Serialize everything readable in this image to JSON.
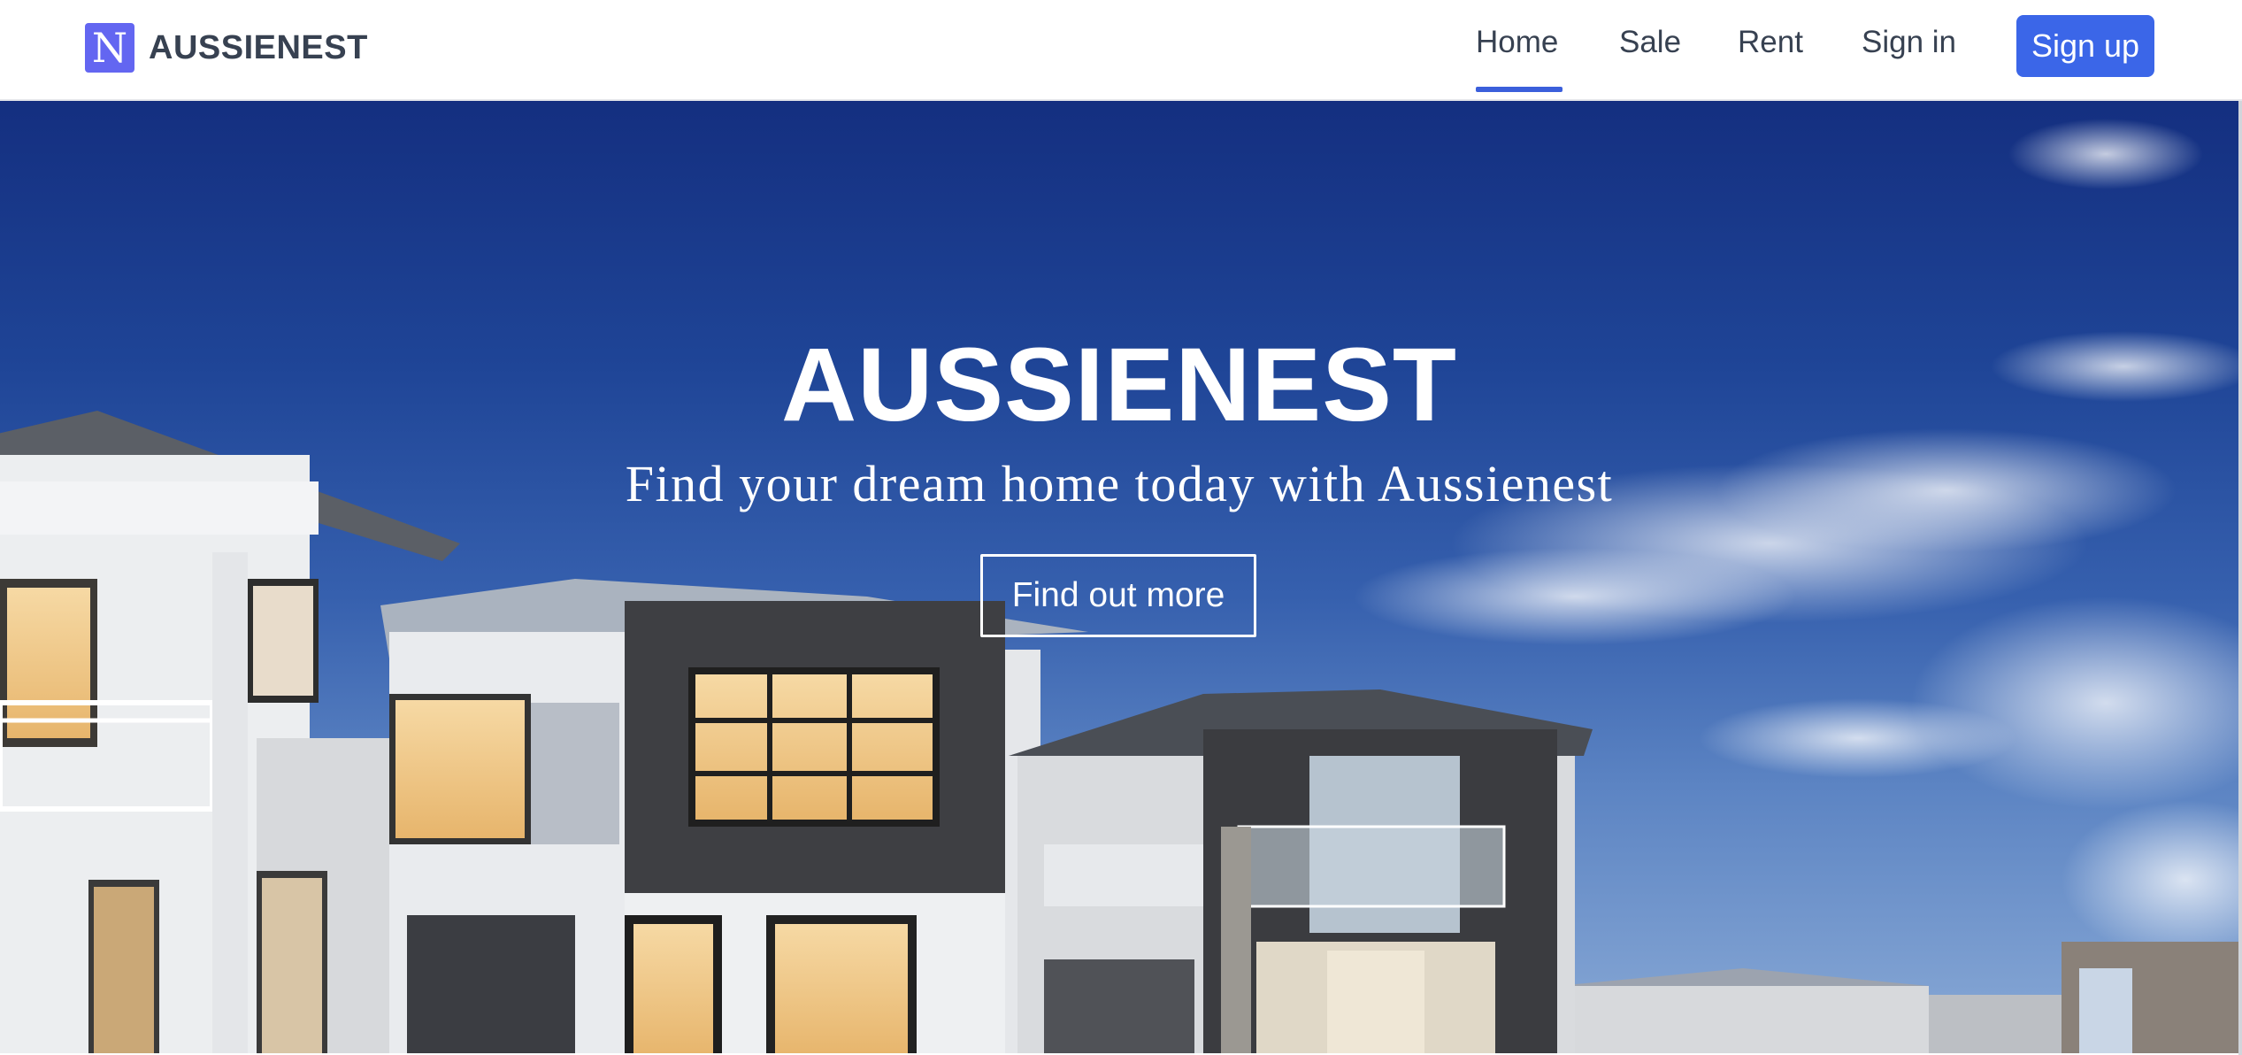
{
  "navbar": {
    "logo_letter": "N",
    "brand_name": "AUSSIENEST",
    "links": [
      {
        "label": "Home",
        "active": true
      },
      {
        "label": "Sale",
        "active": false
      },
      {
        "label": "Rent",
        "active": false
      },
      {
        "label": "Sign in",
        "active": false
      }
    ],
    "signup_label": "Sign up"
  },
  "hero": {
    "title": "AUSSIENEST",
    "subtitle": "Find your dream home today with Aussienest",
    "cta_label": "Find out more"
  },
  "colors": {
    "brand_logo_bg": "#6366f1",
    "primary_button": "#3b66e8",
    "active_underline": "#3b5fdb",
    "nav_text": "#374151",
    "sky_top": "#142f80",
    "sky_bottom": "#8aaad6"
  }
}
